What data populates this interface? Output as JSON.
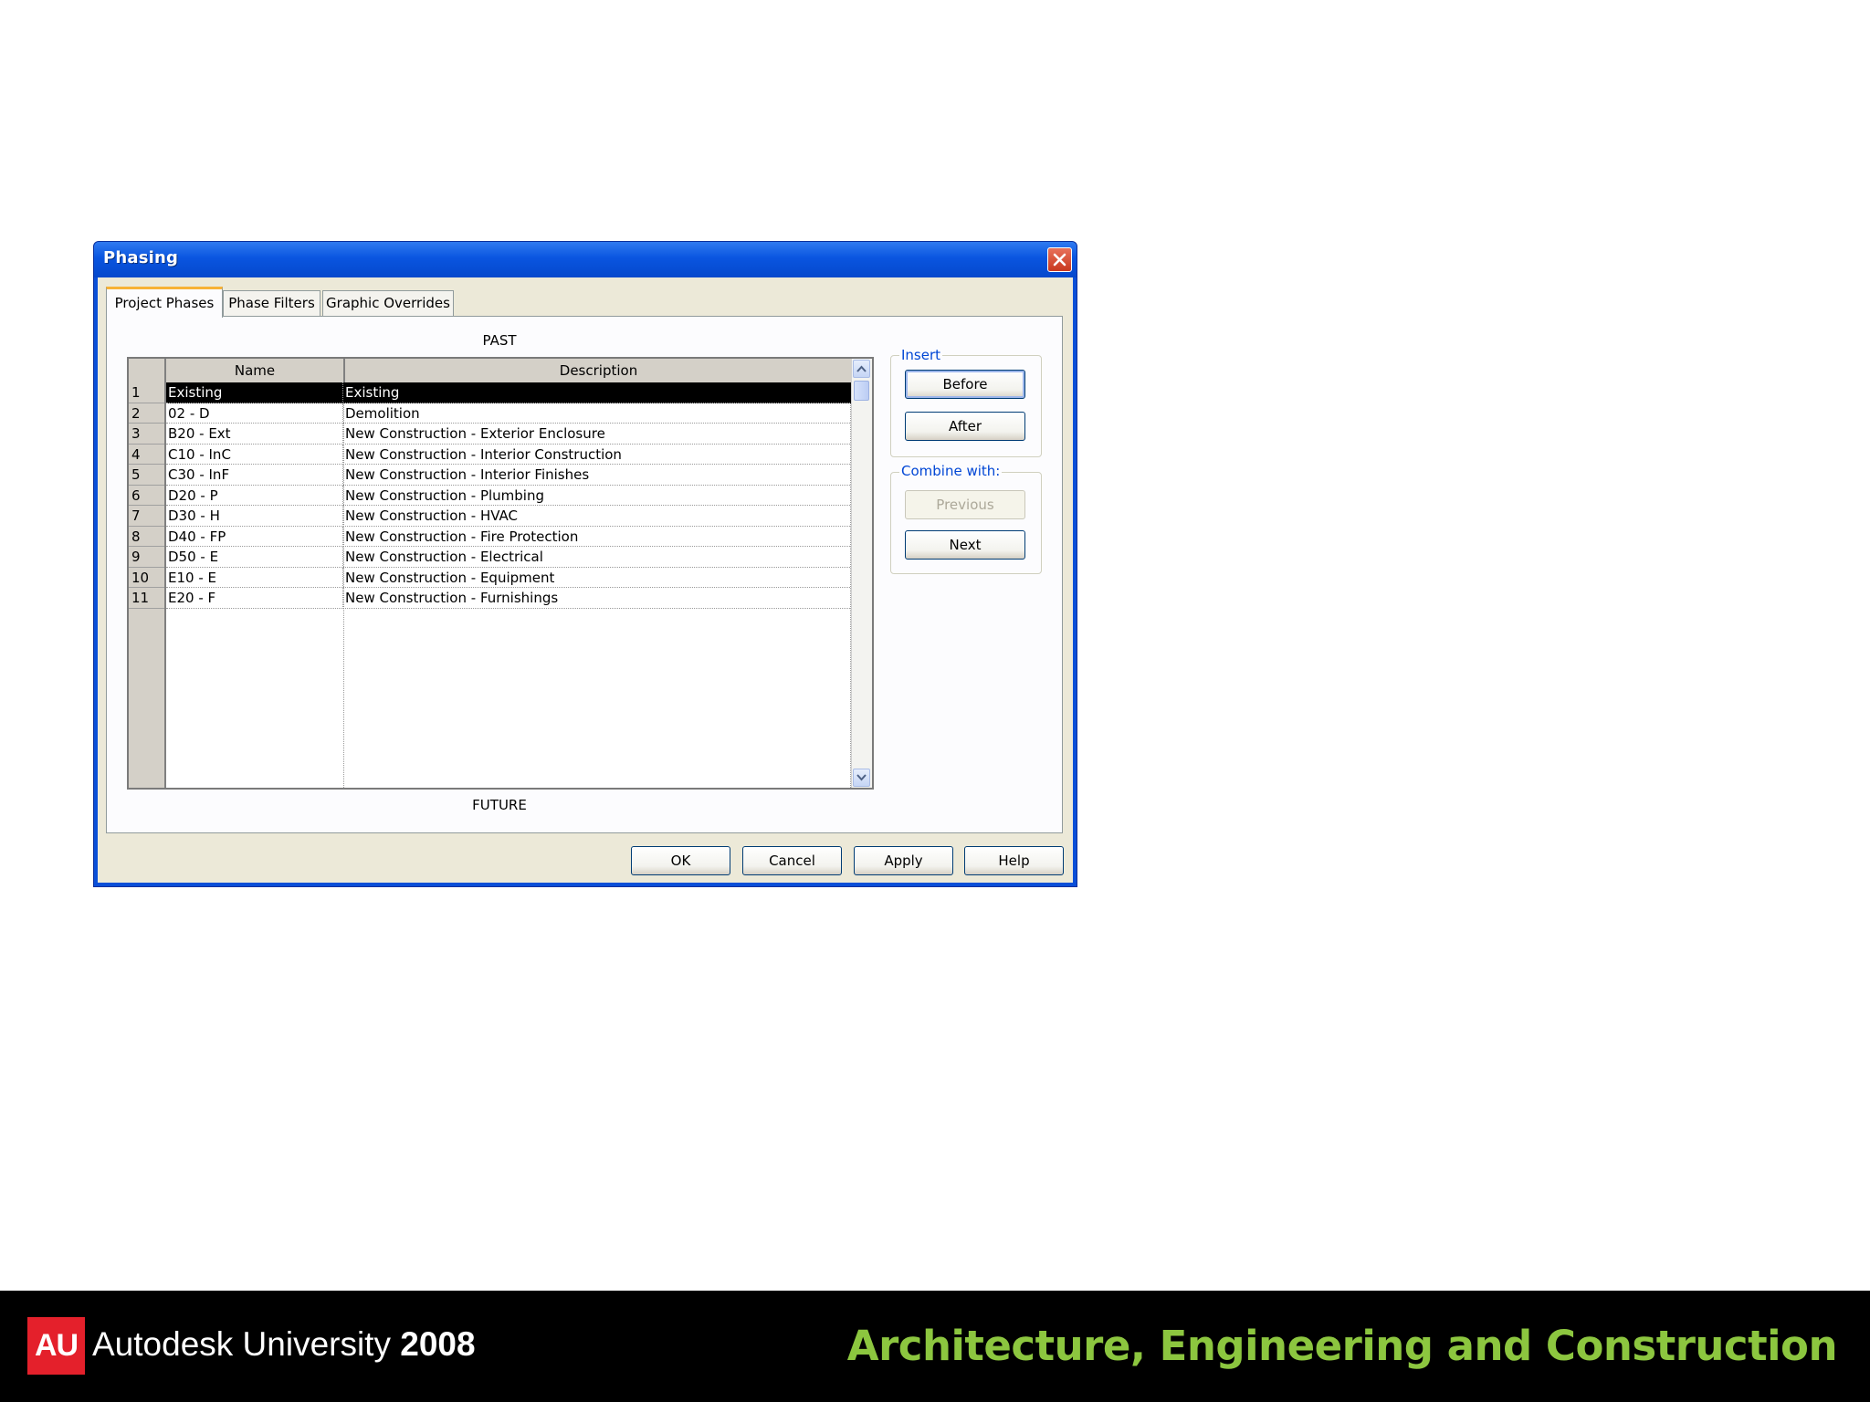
{
  "dialog": {
    "title": "Phasing",
    "tabs": [
      {
        "label": "Project Phases"
      },
      {
        "label": "Phase Filters"
      },
      {
        "label": "Graphic Overrides"
      }
    ],
    "past_label": "PAST",
    "future_label": "FUTURE",
    "grid": {
      "columns": [
        "Name",
        "Description"
      ],
      "rows": [
        {
          "num": "1",
          "name": "Existing",
          "description": "Existing"
        },
        {
          "num": "2",
          "name": "02 - D",
          "description": "Demolition"
        },
        {
          "num": "3",
          "name": "B20 - Ext",
          "description": "New Construction - Exterior Enclosure"
        },
        {
          "num": "4",
          "name": "C10 - InC",
          "description": "New Construction - Interior Construction"
        },
        {
          "num": "5",
          "name": "C30 - InF",
          "description": "New Construction - Interior Finishes"
        },
        {
          "num": "6",
          "name": "D20 - P",
          "description": "New Construction - Plumbing"
        },
        {
          "num": "7",
          "name": "D30 - H",
          "description": "New Construction - HVAC"
        },
        {
          "num": "8",
          "name": "D40 - FP",
          "description": "New Construction - Fire Protection"
        },
        {
          "num": "9",
          "name": "D50 - E",
          "description": "New Construction - Electrical"
        },
        {
          "num": "10",
          "name": "E10 - E",
          "description": "New Construction - Equipment"
        },
        {
          "num": "11",
          "name": "E20 - F",
          "description": "New Construction - Furnishings"
        }
      ]
    },
    "insert_group": {
      "label": "Insert",
      "before": "Before",
      "after": "After"
    },
    "combine_group": {
      "label": "Combine with:",
      "previous": "Previous",
      "next": "Next"
    },
    "buttons": {
      "ok": "OK",
      "cancel": "Cancel",
      "apply": "Apply",
      "help": "Help"
    }
  },
  "footer": {
    "logo": "AU",
    "brand": "Autodesk University",
    "year": "2008",
    "tagline": "Architecture, Engineering and Construction"
  },
  "colors": {
    "title_bar": "#0a55e0",
    "selected_row": "#000000",
    "footer_bg": "#000000",
    "tagline": "#8cc63f",
    "logo_red": "#e4202b"
  }
}
